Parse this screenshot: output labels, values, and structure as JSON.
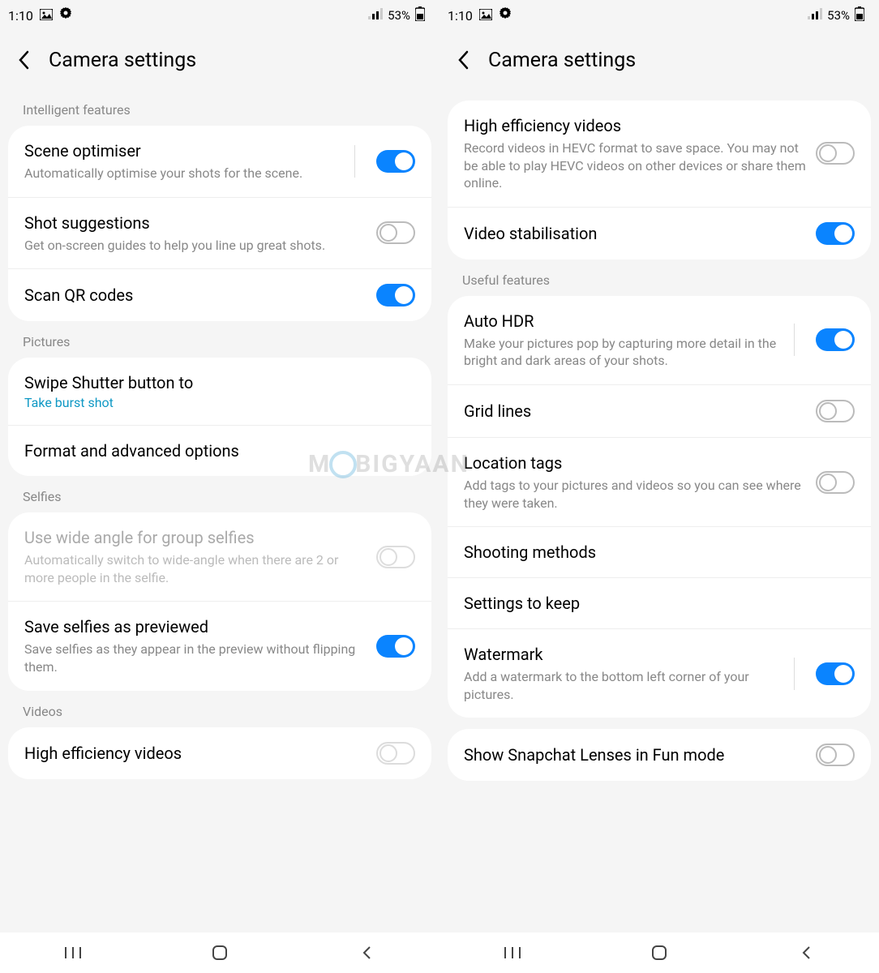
{
  "status": {
    "time": "1:10",
    "battery": "53%"
  },
  "header": {
    "title": "Camera settings"
  },
  "watermark": {
    "pre": "M",
    "post": "BIGYAAN"
  },
  "left": {
    "section1": "Intelligent features",
    "scene": {
      "title": "Scene optimiser",
      "sub": "Automatically optimise your shots for the scene."
    },
    "shot": {
      "title": "Shot suggestions",
      "sub": "Get on-screen guides to help you line up great shots."
    },
    "qr": {
      "title": "Scan QR codes"
    },
    "section2": "Pictures",
    "swipe": {
      "title": "Swipe Shutter button to",
      "value": "Take burst shot"
    },
    "format": {
      "title": "Format and advanced options"
    },
    "section3": "Selfies",
    "wide": {
      "title": "Use wide angle for group selfies",
      "sub": "Automatically switch to wide-angle when there are 2 or more people in the selfie."
    },
    "save": {
      "title": "Save selfies as previewed",
      "sub": "Save selfies as they appear in the preview without flipping them."
    },
    "section4": "Videos",
    "hev": {
      "title": "High efficiency videos"
    }
  },
  "right": {
    "hev": {
      "title": "High efficiency videos",
      "sub": "Record videos in HEVC format to save space. You may not be able to play HEVC videos on other devices or share them online."
    },
    "stab": {
      "title": "Video stabilisation"
    },
    "section1": "Useful features",
    "hdr": {
      "title": "Auto HDR",
      "sub": "Make your pictures pop by capturing more detail in the bright and dark areas of your shots."
    },
    "grid": {
      "title": "Grid lines"
    },
    "loc": {
      "title": "Location tags",
      "sub": "Add tags to your pictures and videos so you can see where they were taken."
    },
    "shoot": {
      "title": "Shooting methods"
    },
    "keep": {
      "title": "Settings to keep"
    },
    "wm": {
      "title": "Watermark",
      "sub": "Add a watermark to the bottom left corner of your pictures."
    },
    "snap": {
      "title": "Show Snapchat Lenses in Fun mode"
    }
  }
}
